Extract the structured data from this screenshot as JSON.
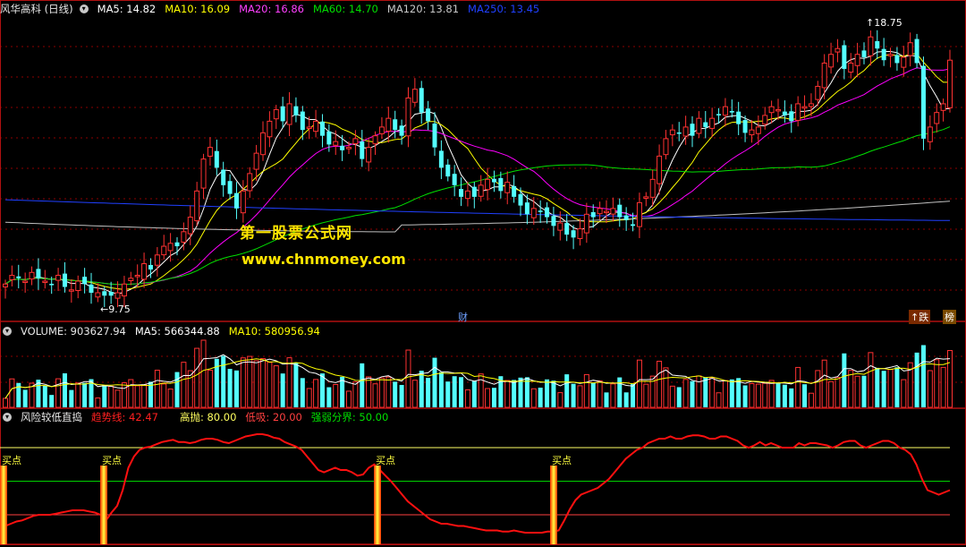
{
  "price_header": {
    "title": "风华高科 (日线)",
    "ma5": "MA5: 14.82",
    "ma10": "MA10: 16.09",
    "ma20": "MA20: 16.86",
    "ma60": "MA60: 14.70",
    "ma120": "MA120: 13.81",
    "ma250": "MA250: 13.45"
  },
  "volume_header": {
    "volume": "VOLUME: 903627.94",
    "ma5": "MA5: 566344.88",
    "ma10": "MA10: 580956.94"
  },
  "indicator_header": {
    "name": "风险较低直捣",
    "trend": "趋势线: 42.47",
    "high": "高抛: 80.00",
    "low": "低吸: 20.00",
    "mid": "强弱分界: 50.00"
  },
  "watermark": {
    "line1": "第一股票公式网",
    "line2": "www.chnmoney.com"
  },
  "markers": {
    "high_price": "18.75",
    "low_price": "9.75",
    "cai": "财",
    "die": "跌",
    "bang": "榜"
  },
  "colors": {
    "up": "#ff3232",
    "down": "#54ffff",
    "ma5": "#ffffff",
    "ma10": "#ffff00",
    "ma20": "#ff00ff",
    "ma60": "#00e000",
    "ma120": "#c0c0c0",
    "ma250": "#2040ff",
    "trend": "#ff1010",
    "grid": "#8b0000"
  },
  "chart_data": [
    {
      "type": "candlestick",
      "title": "风华高科 (日线)",
      "series": [
        {
          "name": "MA5",
          "last": 14.82
        },
        {
          "name": "MA10",
          "last": 16.09
        },
        {
          "name": "MA20",
          "last": 16.86
        },
        {
          "name": "MA60",
          "last": 14.7
        },
        {
          "name": "MA120",
          "last": 13.81
        },
        {
          "name": "MA250",
          "last": 13.45
        }
      ],
      "close": [
        10.2,
        10.5,
        10.4,
        10.3,
        10.6,
        10.4,
        10.3,
        10.2,
        10.5,
        10.1,
        10.0,
        10.3,
        10.2,
        9.9,
        9.9,
        9.8,
        9.8,
        9.9,
        10.2,
        10.4,
        10.5,
        10.9,
        10.7,
        11.2,
        11.5,
        11.6,
        11.5,
        12.0,
        12.5,
        13.4,
        14.5,
        14.9,
        14.2,
        13.6,
        13.3,
        12.8,
        13.4,
        14.0,
        14.7,
        15.4,
        15.8,
        16.2,
        15.8,
        16.4,
        16.0,
        15.5,
        15.6,
        15.8,
        15.3,
        15.0,
        15.1,
        14.8,
        14.9,
        15.2,
        14.5,
        14.9,
        15.3,
        15.6,
        15.9,
        15.5,
        15.3,
        16.6,
        16.9,
        16.1,
        15.8,
        14.9,
        14.2,
        13.9,
        13.6,
        13.2,
        13.4,
        13.2,
        13.6,
        13.8,
        13.7,
        13.4,
        13.7,
        13.2,
        12.9,
        12.6,
        12.8,
        12.7,
        12.5,
        12.2,
        12.3,
        11.9,
        11.8,
        12.1,
        12.6,
        12.5,
        12.8,
        12.7,
        12.8,
        12.5,
        12.4,
        12.2,
        13.0,
        13.2,
        13.8,
        14.6,
        15.2,
        15.5,
        15.4,
        15.6,
        15.3,
        15.9,
        15.6,
        15.9,
        16.0,
        16.3,
        16.1,
        15.7,
        15.4,
        15.5,
        15.6,
        16.0,
        16.3,
        16.2,
        16.0,
        15.8,
        16.4,
        16.3,
        16.4,
        17.0,
        17.8,
        18.1,
        18.3,
        17.6,
        17.8,
        18.1,
        18.0,
        18.7,
        18.3,
        17.9,
        18.1,
        17.8,
        18.0,
        18.5,
        17.8,
        15.2,
        15.6,
        16.1,
        16.4,
        17.9
      ]
    },
    {
      "type": "bar",
      "title": "VOLUME",
      "series": [
        {
          "name": "VOLUME",
          "last": 903627.94
        },
        {
          "name": "MA5",
          "last": 566344.88
        },
        {
          "name": "MA10",
          "last": 580956.94
        }
      ]
    },
    {
      "type": "line",
      "title": "风险较低直捣",
      "series": [
        {
          "name": "趋势线",
          "last": 42.47,
          "values": [
            10,
            12,
            14,
            15,
            17,
            19,
            20,
            20,
            20,
            21,
            22,
            23,
            24,
            24,
            24,
            23,
            22,
            20,
            15,
            22,
            28,
            42,
            62,
            72,
            78,
            80,
            81,
            83,
            85,
            86,
            87,
            85,
            85,
            84,
            85,
            87,
            88,
            88,
            87,
            85,
            84,
            86,
            88,
            90,
            91,
            92,
            92,
            91,
            89,
            88,
            85,
            83,
            81,
            78,
            72,
            66,
            60,
            58,
            60,
            62,
            60,
            60,
            58,
            55,
            56,
            62,
            65,
            60,
            55,
            50,
            44,
            38,
            32,
            28,
            24,
            20,
            16,
            14,
            12,
            12,
            11,
            10,
            10,
            9,
            8,
            7,
            6,
            6,
            6,
            5,
            5,
            6,
            5,
            4,
            4,
            4,
            4,
            5,
            5,
            6,
            15,
            25,
            33,
            38,
            40,
            42,
            44,
            48,
            52,
            58,
            64,
            70,
            74,
            78,
            80,
            84,
            86,
            88,
            88,
            90,
            88,
            88,
            90,
            91,
            91,
            90,
            88,
            88,
            90,
            90,
            88,
            86,
            82,
            80,
            82,
            85,
            82,
            84,
            82,
            80,
            80,
            80,
            84,
            82,
            84,
            84,
            83,
            82,
            80,
            82,
            85,
            86,
            86,
            82,
            80,
            82,
            84,
            86,
            86,
            84,
            80,
            78,
            74,
            65,
            52,
            42,
            40,
            38,
            40,
            42
          ]
        }
      ],
      "reference_lines": [
        80,
        50,
        20
      ],
      "buy_labels": [
        "买点",
        "买点",
        "买点",
        "买点"
      ]
    }
  ]
}
